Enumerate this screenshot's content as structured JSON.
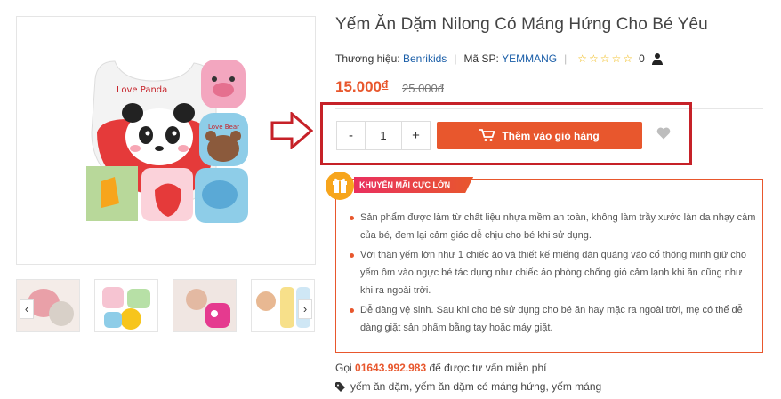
{
  "product": {
    "title": "Yếm Ăn Dặm Nilong Có Máng Hứng Cho Bé Yêu",
    "brand_label": "Thương hiệu:",
    "brand": "Benrikids",
    "sku_label": "Mã SP:",
    "sku": "YEMMANG",
    "rating_stars": "☆☆☆☆☆",
    "review_count": "0",
    "price": "15.000",
    "currency_symbol": "đ",
    "old_price": "25.000đ"
  },
  "main_image": {
    "bib_text_1": "Love Panda",
    "bib_text_2": "Love Bear"
  },
  "gallery": {
    "prev_arrow": "‹",
    "next_arrow": "›"
  },
  "purchase": {
    "minus_label": "-",
    "quantity": "1",
    "plus_label": "+",
    "add_to_cart_label": "Thêm vào giỏ hàng"
  },
  "promo": {
    "badge": "KHUYẾN MÃI CỰC LỚN",
    "items": [
      "Sản phẩm được làm từ chất liệu nhựa mềm an toàn, không làm trầy xước làn da nhạy cảm của bé, đem lại cảm giác dễ chịu cho bé khi sử dụng.",
      "Với thân yếm lớn như 1 chiếc áo và thiết kế miếng dán quàng vào cổ thông minh giữ cho yếm ôm vào ngực bé tác dụng như chiếc áo phòng chống gió cảm lạnh khi ăn cũng như khi ra ngoài trời.",
      "Dễ dàng vệ sinh. Sau khi cho bé sử dụng cho bé ăn hay mặc ra ngoài trời, mẹ có thể dễ dàng giặt sản phẩm bằng tay hoặc máy giặt."
    ]
  },
  "hotline": {
    "prefix": "Gọi",
    "phone": "01643.992.983",
    "suffix": "để được tư vấn miễn phí"
  },
  "tags": "yếm ăn dặm, yếm ăn dặm có máng hứng, yếm máng",
  "colors": {
    "accent": "#e8572d",
    "highlight_frame": "#c62128",
    "link": "#1a5ea8",
    "star": "#f0b70b"
  }
}
